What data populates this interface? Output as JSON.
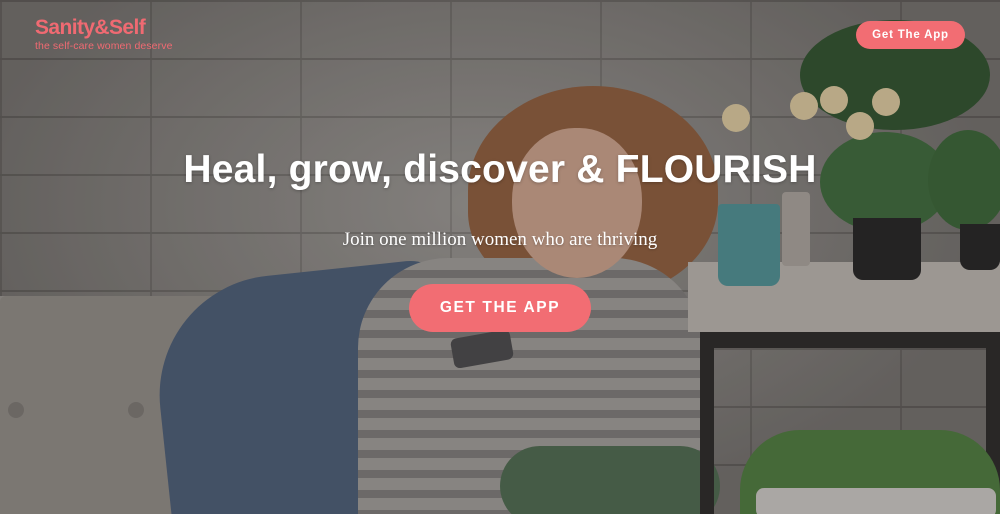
{
  "brand": {
    "name": "Sanity&Self",
    "tagline": "the self-care women deserve",
    "accent_color": "#f26d73"
  },
  "nav": {
    "cta_label": "Get The App"
  },
  "hero": {
    "headline": "Heal, grow, discover & FLOURISH",
    "subheadline": "Join one million women who are thriving",
    "cta_label": "GET THE APP",
    "background": "photo-woman-on-sofa-with-phone"
  }
}
